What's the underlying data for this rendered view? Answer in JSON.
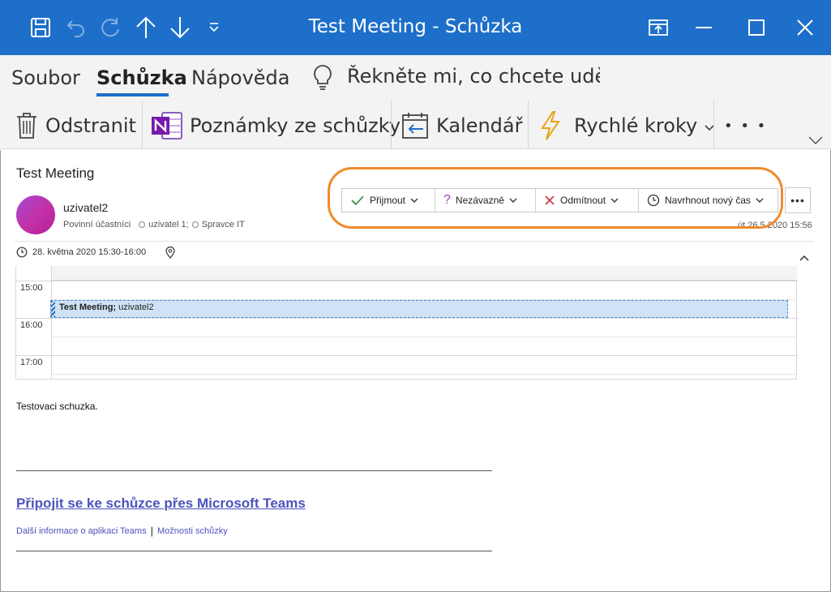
{
  "window": {
    "title": "Test Meeting  -  Schůzka",
    "controls": [
      "restore-ribbon",
      "minimize",
      "maximize",
      "close"
    ]
  },
  "tabs": {
    "items": [
      {
        "label": "Soubor",
        "active": false
      },
      {
        "label": "Schůzka",
        "active": true
      },
      {
        "label": "Nápověda",
        "active": false
      }
    ],
    "tell_me": "Řekněte mi, co chcete uděl"
  },
  "ribbon": {
    "delete": "Odstranit",
    "notes": "Poznámky ze schůzky",
    "calendar": "Kalendář",
    "quick_steps": "Rychlé kroky",
    "more": "• • •"
  },
  "meeting": {
    "subject": "Test Meeting",
    "sender": "uzivatel2",
    "required_label": "Povinní účastníci",
    "attendees": [
      "uzivatel 1;",
      "Spravce IT"
    ],
    "sent": "út 26.5.2020 15:56",
    "when": "28. května 2020 15:30-16:00"
  },
  "response": {
    "accept": "Přijmout",
    "tentative": "Nezávazně",
    "decline": "Odmítnout",
    "propose": "Navrhnout nový čas",
    "more": "•••"
  },
  "calendar": {
    "times": [
      "15:00",
      "16:00",
      "17:00"
    ],
    "event_title": "Test Meeting;",
    "event_organizer": "uzivatel2"
  },
  "body": {
    "text": "Testovaci schuzka.",
    "teams_link": "Připojit se ke schůzce přes Microsoft Teams",
    "learn_more": "Další informace o aplikaci Teams",
    "separator": "|",
    "options": "Možnosti schůzky"
  },
  "colors": {
    "titlebar": "#1d6fc9",
    "accent": "#1d6fc9",
    "highlight": "#f08a2c",
    "link": "#4b53bc"
  }
}
